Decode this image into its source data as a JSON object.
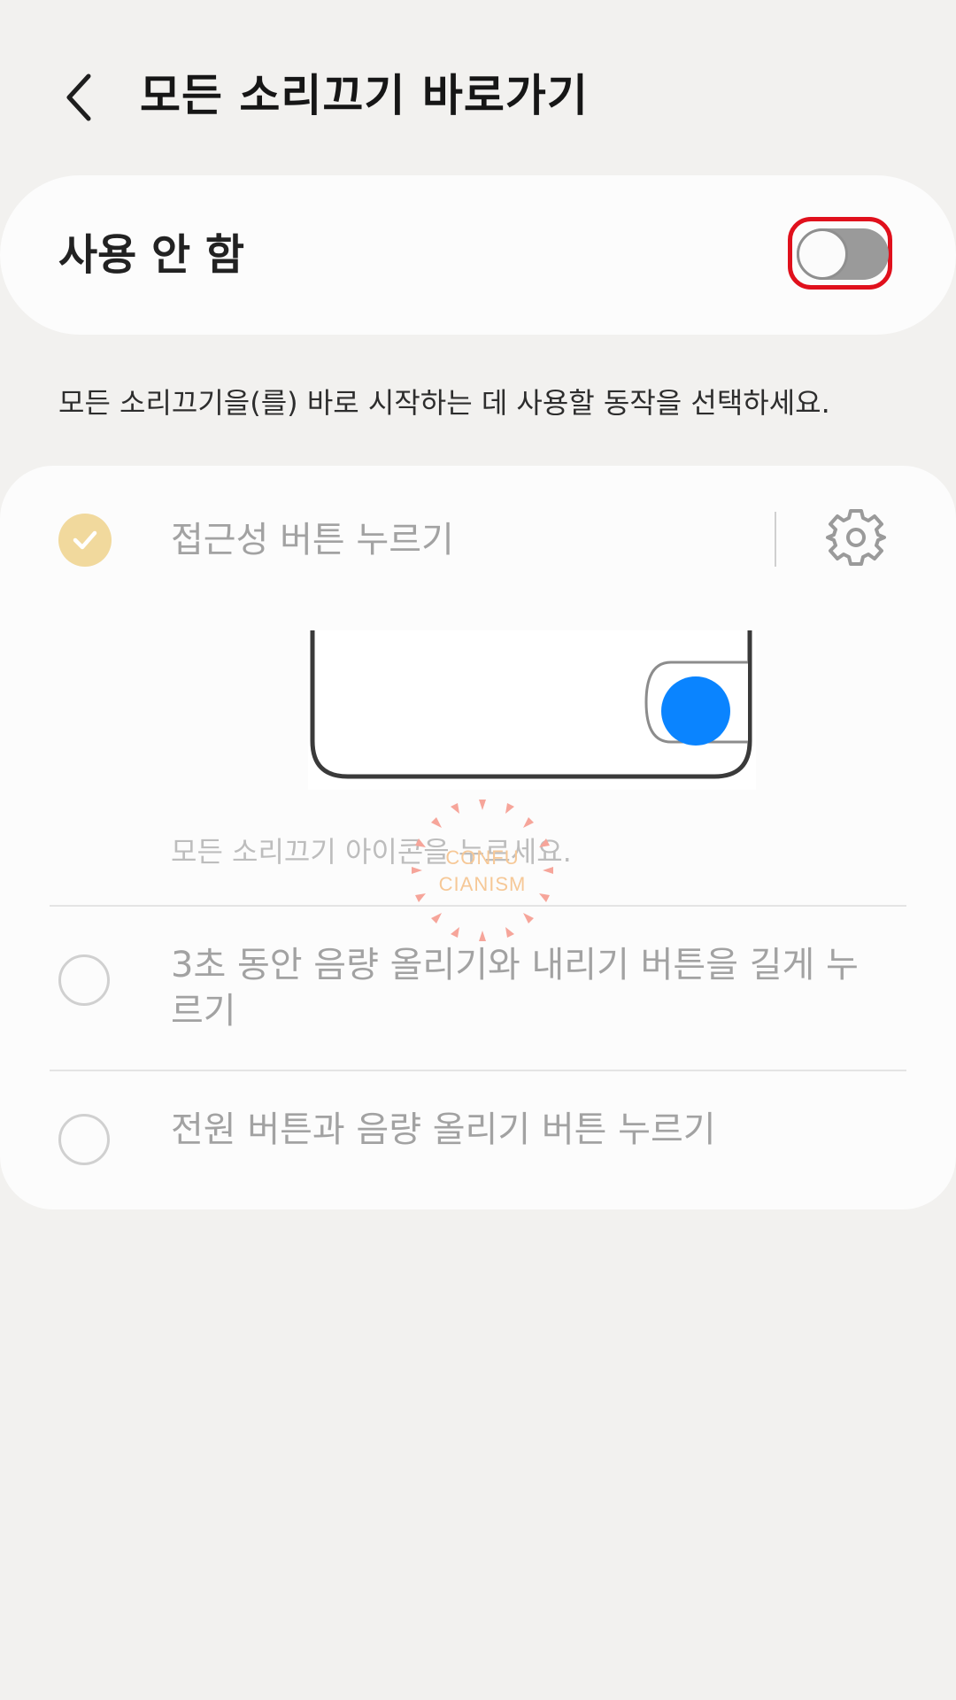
{
  "header": {
    "title": "모든 소리끄기 바로가기"
  },
  "master": {
    "label": "사용 안 함",
    "enabled": false
  },
  "description": "모든 소리끄기을(를) 바로 시작하는 데 사용할 동작을 선택하세요.",
  "options": [
    {
      "label": "접근성 버튼 누르기",
      "selected": true,
      "hint": "모든 소리끄기 아이콘을 누르세요."
    },
    {
      "label": "3초 동안 음량 올리기와 내리기 버튼을 길게 누르기",
      "selected": false
    },
    {
      "label": "전원 버튼과 음량 올리기 버튼 누르기",
      "selected": false
    }
  ],
  "watermark": {
    "line1": "CONFU",
    "line2": "CIANISM"
  },
  "colors": {
    "background": "#f2f1ef",
    "card": "#fcfcfc",
    "toggle_off_track": "#9a9a9a",
    "highlight": "#e0101c",
    "selected_check": "#f1d99d",
    "accessibility_button": "#0a84ff",
    "disabled_text": "#a2a2a2"
  },
  "icons": {
    "back": "chevron-left-icon",
    "settings": "gear-icon",
    "check": "check-icon"
  }
}
